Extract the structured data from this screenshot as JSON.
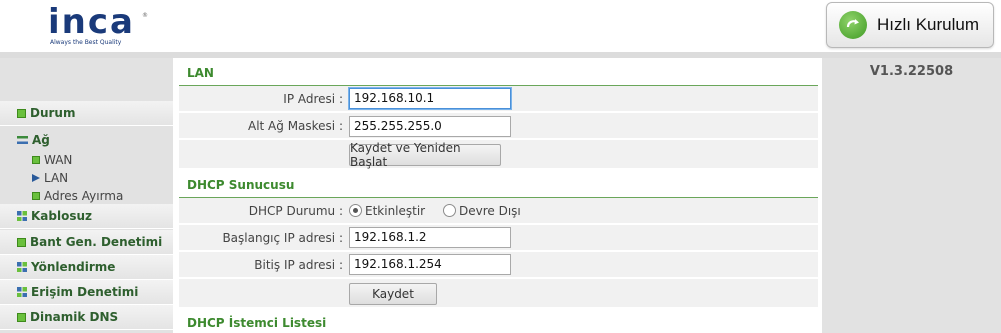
{
  "header": {
    "logo": {
      "text": "inca",
      "reg": "®",
      "tagline": "Always the Best Quality"
    },
    "quick_setup_label": "Hızlı Kurulum"
  },
  "sidebar": {
    "items": [
      {
        "label": "Durum",
        "icon": "green-square-icon"
      },
      {
        "label": "Ağ",
        "icon": "bars-icon"
      },
      {
        "label": "Kablosuz",
        "icon": "grid-icon"
      },
      {
        "label": "Bant Gen. Denetimi",
        "icon": "green-square-icon"
      },
      {
        "label": "Yönlendirme",
        "icon": "grid-icon"
      },
      {
        "label": "Erişim Denetimi",
        "icon": "grid-icon"
      },
      {
        "label": "Dinamik DNS",
        "icon": "green-square-icon"
      }
    ],
    "subitems": [
      {
        "label": "WAN",
        "icon": "green-square-icon"
      },
      {
        "label": "LAN",
        "icon": "arrow-icon"
      },
      {
        "label": "Adres Ayırma",
        "icon": "green-square-icon"
      }
    ]
  },
  "lan": {
    "title": "LAN",
    "ip_label": "IP Adresi :",
    "ip_value": "192.168.10.1",
    "mask_label": "Alt Ağ Maskesi :",
    "mask_value": "255.255.255.0",
    "save_restart_label": "Kaydet ve Yeniden Başlat"
  },
  "dhcp": {
    "title": "DHCP Sunucusu",
    "status_label": "DHCP Durumu :",
    "enable_label": "Etkinleştir",
    "disable_label": "Devre Dışı",
    "enabled": true,
    "start_label": "Başlangıç IP adresi :",
    "start_value": "192.168.1.2",
    "end_label": "Bitiş IP adresi :",
    "end_value": "192.168.1.254",
    "save_label": "Kaydet"
  },
  "client_list": {
    "title": "DHCP İstemci Listesi"
  },
  "version": "V1.3.22508",
  "colors": {
    "section_title": "#3d8a2f",
    "nav_text": "#2e5f2e",
    "focus_border": "#4a90d9"
  }
}
